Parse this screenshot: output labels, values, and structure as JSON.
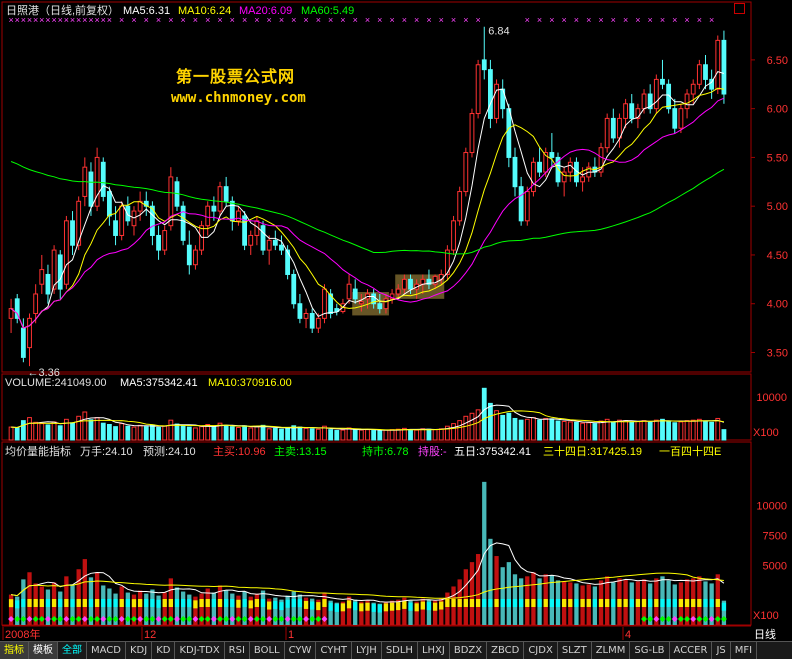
{
  "header": {
    "stock_label": "日照港（日线,前复权）",
    "ma5": "MA5:6.31",
    "ma10": "MA10:6.24",
    "ma20": "MA20:6.09",
    "ma60": "MA60:5.49"
  },
  "watermark": {
    "line1": "第一股票公式网",
    "line2": "www.chnmoney.com"
  },
  "annotations": {
    "high": "6.84",
    "low": "←3.36"
  },
  "volume_header": {
    "volume": "VOLUME:241049.00",
    "ma5": "MA5:375342.41",
    "ma10": "MA10:370916.00"
  },
  "indicator_header": {
    "name": "均价量能指标",
    "wanshou": "万手:24.10",
    "yuce": "预测:24.10",
    "zhumai": "主买:10.96",
    "zhumai2": "主卖:13.15",
    "chishi": "持市:6.78",
    "chigu": "持股:-",
    "wuri": "五日:375342.41",
    "sanshisi": "三十四日:317425.19",
    "yibai": "一百四十四E"
  },
  "time_axis": {
    "labels": [
      "2008年",
      "12",
      "1",
      "4"
    ],
    "period": "日线"
  },
  "tabs": [
    "指标",
    "模板",
    "全部",
    "MACD",
    "KDJ",
    "KD",
    "KDJ-TDX",
    "RSI",
    "BOLL",
    "CYW",
    "CYHT",
    "LYJH",
    "SDLH",
    "LHXJ",
    "BDZX",
    "ZBCD",
    "CJDX",
    "SLZT",
    "ZLMM",
    "SG-LB",
    "ACCER",
    "JS",
    "MFI"
  ],
  "colors": {
    "up": "#ff3232",
    "down": "#54fcfc",
    "ma5": "#ffffff",
    "ma10": "#ffff00",
    "ma20": "#ff00ff",
    "ma60": "#00ff00",
    "grid": "#800000"
  },
  "chart_data": [
    {
      "type": "candlestick",
      "y_ticks": [
        3.5,
        4.0,
        4.5,
        5.0,
        5.5,
        6.0,
        6.5
      ],
      "ylim": [
        3.3,
        6.95
      ],
      "ohlc": [
        [
          3.85,
          4.05,
          3.7,
          3.95
        ],
        [
          4.05,
          4.1,
          3.8,
          3.85
        ],
        [
          3.75,
          3.85,
          3.4,
          3.45
        ],
        [
          3.55,
          3.9,
          3.36,
          3.85
        ],
        [
          3.9,
          4.2,
          3.8,
          4.1
        ],
        [
          4.2,
          4.5,
          4.1,
          4.35
        ],
        [
          4.3,
          4.4,
          4.0,
          4.1
        ],
        [
          4.15,
          4.6,
          4.1,
          4.55
        ],
        [
          4.5,
          4.55,
          4.05,
          4.15
        ],
        [
          4.2,
          4.9,
          4.15,
          4.85
        ],
        [
          4.85,
          4.95,
          4.5,
          4.6
        ],
        [
          4.6,
          5.1,
          4.55,
          5.05
        ],
        [
          5.1,
          5.5,
          5.0,
          5.4
        ],
        [
          5.35,
          5.45,
          4.9,
          5.0
        ],
        [
          5.0,
          5.6,
          4.95,
          5.5
        ],
        [
          5.45,
          5.5,
          5.05,
          5.1
        ],
        [
          5.15,
          5.2,
          4.8,
          4.9
        ],
        [
          4.85,
          5.0,
          4.6,
          4.7
        ],
        [
          4.7,
          5.05,
          4.65,
          5.0
        ],
        [
          5.0,
          5.1,
          4.8,
          4.85
        ],
        [
          4.8,
          5.0,
          4.7,
          4.95
        ],
        [
          4.95,
          5.15,
          4.85,
          5.05
        ],
        [
          5.05,
          5.15,
          4.9,
          5.0
        ],
        [
          5.0,
          5.05,
          4.6,
          4.7
        ],
        [
          4.7,
          4.8,
          4.45,
          4.55
        ],
        [
          4.55,
          4.8,
          4.5,
          4.75
        ],
        [
          4.8,
          5.4,
          4.75,
          5.3
        ],
        [
          5.25,
          5.3,
          4.95,
          5.0
        ],
        [
          5.0,
          5.05,
          4.6,
          4.65
        ],
        [
          4.6,
          4.75,
          4.3,
          4.4
        ],
        [
          4.4,
          4.6,
          4.35,
          4.55
        ],
        [
          4.55,
          4.85,
          4.5,
          4.8
        ],
        [
          4.8,
          5.05,
          4.7,
          5.0
        ],
        [
          5.0,
          5.1,
          4.85,
          4.95
        ],
        [
          4.95,
          5.25,
          4.9,
          5.2
        ],
        [
          5.2,
          5.3,
          5.0,
          5.05
        ],
        [
          5.05,
          5.1,
          4.75,
          4.85
        ],
        [
          4.85,
          5.0,
          4.8,
          4.95
        ],
        [
          4.9,
          4.95,
          4.55,
          4.6
        ],
        [
          4.6,
          4.75,
          4.5,
          4.7
        ],
        [
          4.7,
          4.9,
          4.6,
          4.85
        ],
        [
          4.8,
          4.85,
          4.5,
          4.55
        ],
        [
          4.55,
          4.7,
          4.4,
          4.65
        ],
        [
          4.65,
          4.75,
          4.55,
          4.6
        ],
        [
          4.6,
          4.7,
          4.5,
          4.55
        ],
        [
          4.55,
          4.6,
          4.25,
          4.3
        ],
        [
          4.3,
          4.35,
          3.95,
          4.0
        ],
        [
          4.0,
          4.1,
          3.8,
          3.85
        ],
        [
          3.85,
          3.95,
          3.75,
          3.9
        ],
        [
          3.9,
          3.95,
          3.7,
          3.75
        ],
        [
          3.75,
          3.9,
          3.7,
          3.85
        ],
        [
          3.85,
          4.2,
          3.8,
          4.15
        ],
        [
          4.1,
          4.15,
          3.85,
          3.9
        ],
        [
          3.95,
          4.0,
          3.88,
          3.92
        ],
        [
          3.92,
          4.05,
          3.9,
          4.0
        ],
        [
          4.05,
          4.3,
          4.0,
          4.2
        ],
        [
          4.15,
          4.25,
          4.0,
          4.05
        ],
        [
          4.0,
          4.1,
          3.92,
          4.02
        ],
        [
          4.05,
          4.15,
          3.95,
          4.1
        ],
        [
          4.1,
          4.15,
          3.95,
          4.0
        ],
        [
          4.0,
          4.1,
          3.9,
          3.95
        ],
        [
          3.95,
          4.1,
          3.9,
          4.05
        ],
        [
          4.05,
          4.15,
          4.0,
          4.1
        ],
        [
          4.1,
          4.2,
          4.05,
          4.15
        ],
        [
          4.15,
          4.3,
          4.1,
          4.25
        ],
        [
          4.25,
          4.3,
          4.1,
          4.15
        ],
        [
          4.15,
          4.25,
          4.05,
          4.2
        ],
        [
          4.2,
          4.3,
          4.1,
          4.25
        ],
        [
          4.25,
          4.35,
          4.15,
          4.2
        ],
        [
          4.2,
          4.3,
          4.15,
          4.28
        ],
        [
          4.25,
          4.35,
          4.2,
          4.3
        ],
        [
          4.3,
          4.6,
          4.25,
          4.55
        ],
        [
          4.55,
          4.9,
          4.5,
          4.85
        ],
        [
          4.85,
          5.2,
          4.8,
          5.15
        ],
        [
          5.15,
          5.6,
          5.1,
          5.55
        ],
        [
          5.55,
          6.0,
          5.5,
          5.95
        ],
        [
          5.95,
          6.5,
          5.9,
          6.45
        ],
        [
          6.5,
          6.84,
          6.3,
          6.4
        ],
        [
          6.4,
          6.5,
          5.8,
          5.9
        ],
        [
          5.9,
          6.3,
          5.85,
          6.25
        ],
        [
          6.2,
          6.3,
          5.9,
          6.0
        ],
        [
          6.0,
          6.05,
          5.4,
          5.5
        ],
        [
          5.5,
          5.6,
          5.1,
          5.2
        ],
        [
          5.2,
          5.3,
          4.8,
          4.85
        ],
        [
          4.85,
          5.2,
          4.8,
          5.15
        ],
        [
          5.15,
          5.5,
          5.1,
          5.45
        ],
        [
          5.45,
          5.6,
          5.3,
          5.35
        ],
        [
          5.35,
          5.6,
          5.3,
          5.55
        ],
        [
          5.55,
          5.75,
          5.4,
          5.5
        ],
        [
          5.5,
          5.55,
          5.2,
          5.25
        ],
        [
          5.25,
          5.4,
          5.1,
          5.35
        ],
        [
          5.35,
          5.5,
          5.25,
          5.45
        ],
        [
          5.45,
          5.5,
          5.2,
          5.25
        ],
        [
          5.25,
          5.4,
          5.15,
          5.3
        ],
        [
          5.3,
          5.45,
          5.25,
          5.4
        ],
        [
          5.4,
          5.5,
          5.3,
          5.35
        ],
        [
          5.35,
          5.65,
          5.3,
          5.6
        ],
        [
          5.6,
          5.95,
          5.55,
          5.9
        ],
        [
          5.9,
          6.0,
          5.65,
          5.7
        ],
        [
          5.7,
          5.95,
          5.6,
          5.9
        ],
        [
          5.9,
          6.1,
          5.8,
          6.05
        ],
        [
          6.05,
          6.15,
          5.85,
          5.9
        ],
        [
          5.9,
          6.05,
          5.8,
          6.0
        ],
        [
          6.0,
          6.2,
          5.95,
          6.15
        ],
        [
          6.15,
          6.25,
          5.95,
          6.0
        ],
        [
          6.0,
          6.35,
          5.95,
          6.3
        ],
        [
          6.3,
          6.5,
          6.2,
          6.25
        ],
        [
          6.25,
          6.3,
          5.95,
          6.0
        ],
        [
          6.0,
          6.1,
          5.75,
          5.8
        ],
        [
          5.8,
          6.05,
          5.75,
          6.0
        ],
        [
          6.0,
          6.2,
          5.9,
          6.15
        ],
        [
          6.15,
          6.3,
          6.05,
          6.25
        ],
        [
          6.25,
          6.5,
          6.2,
          6.45
        ],
        [
          6.45,
          6.55,
          6.2,
          6.3
        ],
        [
          6.3,
          6.4,
          6.1,
          6.2
        ],
        [
          6.2,
          6.75,
          6.15,
          6.7
        ],
        [
          6.7,
          6.8,
          6.05,
          6.15
        ]
      ]
    },
    {
      "type": "bar",
      "name": "VOLUME",
      "y_ticks": [
        10000
      ],
      "axis_unit": "X100",
      "values": [
        3000,
        2800,
        4500,
        5200,
        4100,
        3800,
        3500,
        4200,
        3300,
        4800,
        4000,
        5500,
        6500,
        4700,
        5200,
        3900,
        3600,
        3100,
        3800,
        3200,
        3000,
        3400,
        3100,
        3500,
        2900,
        3200,
        4600,
        3700,
        3300,
        3000,
        2800,
        3100,
        3600,
        3200,
        3900,
        3400,
        3100,
        2900,
        3300,
        2800,
        3100,
        3400,
        2600,
        2700,
        2500,
        2900,
        3300,
        3000,
        2700,
        2600,
        2500,
        3200,
        2400,
        2200,
        2300,
        2800,
        2500,
        2300,
        2400,
        2200,
        2100,
        2300,
        2400,
        2500,
        2700,
        2400,
        2300,
        2600,
        2500,
        2400,
        2600,
        3200,
        3800,
        4500,
        5500,
        6200,
        7000,
        12000,
        8500,
        6800,
        5700,
        6200,
        5000,
        4600,
        4800,
        5200,
        4600,
        5000,
        4900,
        4400,
        4300,
        4200,
        4100,
        3900,
        4000,
        3800,
        4400,
        4800,
        4200,
        4600,
        4500,
        4200,
        4300,
        4500,
        4100,
        4600,
        4800,
        4400,
        4000,
        4200,
        4500,
        4600,
        4800,
        4300,
        4100,
        5000,
        2400
      ]
    }
  ]
}
